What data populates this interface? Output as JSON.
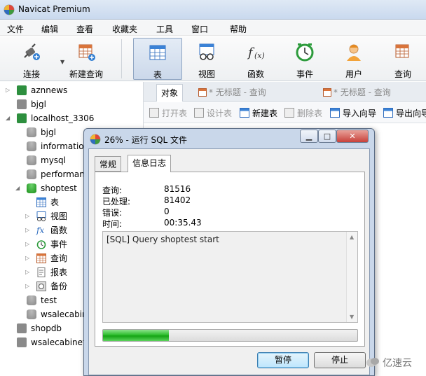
{
  "app": {
    "title": "Navicat Premium"
  },
  "menu": [
    "文件",
    "编辑",
    "查看",
    "收藏夹",
    "工具",
    "窗口",
    "帮助"
  ],
  "toolbar": {
    "connect": "连接",
    "new_query": "新建查询",
    "table": "表",
    "view": "视图",
    "function": "函数",
    "event": "事件",
    "user": "用户",
    "query": "查询"
  },
  "sidebar": {
    "items": [
      {
        "label": "aznnews",
        "icon": "connection-icon"
      },
      {
        "label": "bjgl",
        "icon": "connection-icon"
      },
      {
        "label": "localhost_3306",
        "icon": "connection-icon"
      },
      {
        "label": "bjgl",
        "icon": "database-icon"
      },
      {
        "label": "informatio",
        "icon": "database-icon"
      },
      {
        "label": "mysql",
        "icon": "database-icon"
      },
      {
        "label": "performan",
        "icon": "database-icon"
      },
      {
        "label": "shoptest",
        "icon": "database-icon"
      },
      {
        "label": "表",
        "icon": "table-icon"
      },
      {
        "label": "视图",
        "icon": "view-icon"
      },
      {
        "label": "函数",
        "icon": "function-icon"
      },
      {
        "label": "事件",
        "icon": "event-icon"
      },
      {
        "label": "查询",
        "icon": "query-icon"
      },
      {
        "label": "报表",
        "icon": "report-icon"
      },
      {
        "label": "备份",
        "icon": "backup-icon"
      },
      {
        "label": "test",
        "icon": "database-icon"
      },
      {
        "label": "wsalecabin",
        "icon": "database-icon"
      },
      {
        "label": "shopdb",
        "icon": "connection-icon"
      },
      {
        "label": "wsalecabinet",
        "icon": "connection-icon"
      }
    ]
  },
  "tabs": {
    "objects": "对象",
    "tab1": "* 无标题 - 查询",
    "tab2": "* 无标题 - 查询"
  },
  "object_toolbar": {
    "open": "打开表",
    "design": "设计表",
    "new": "新建表",
    "delete": "删除表",
    "import": "导入向导",
    "export": "导出向导"
  },
  "dialog": {
    "title": "26% - 运行 SQL 文件",
    "tab_general": "常规",
    "tab_log": "信息日志",
    "stats": [
      {
        "label": "查询:",
        "value": "81516"
      },
      {
        "label": "已处理:",
        "value": "81402"
      },
      {
        "label": "错误:",
        "value": "0"
      },
      {
        "label": "时间:",
        "value": "00:35.43"
      }
    ],
    "log": "[SQL] Query shoptest start",
    "progress": 0.26,
    "pause": "暂停",
    "stop": "停止"
  },
  "watermark": "亿速云",
  "colors": {
    "accent": "#3c7fb1",
    "progress": "#2fbf2f",
    "connection": "#2d8f3e"
  }
}
